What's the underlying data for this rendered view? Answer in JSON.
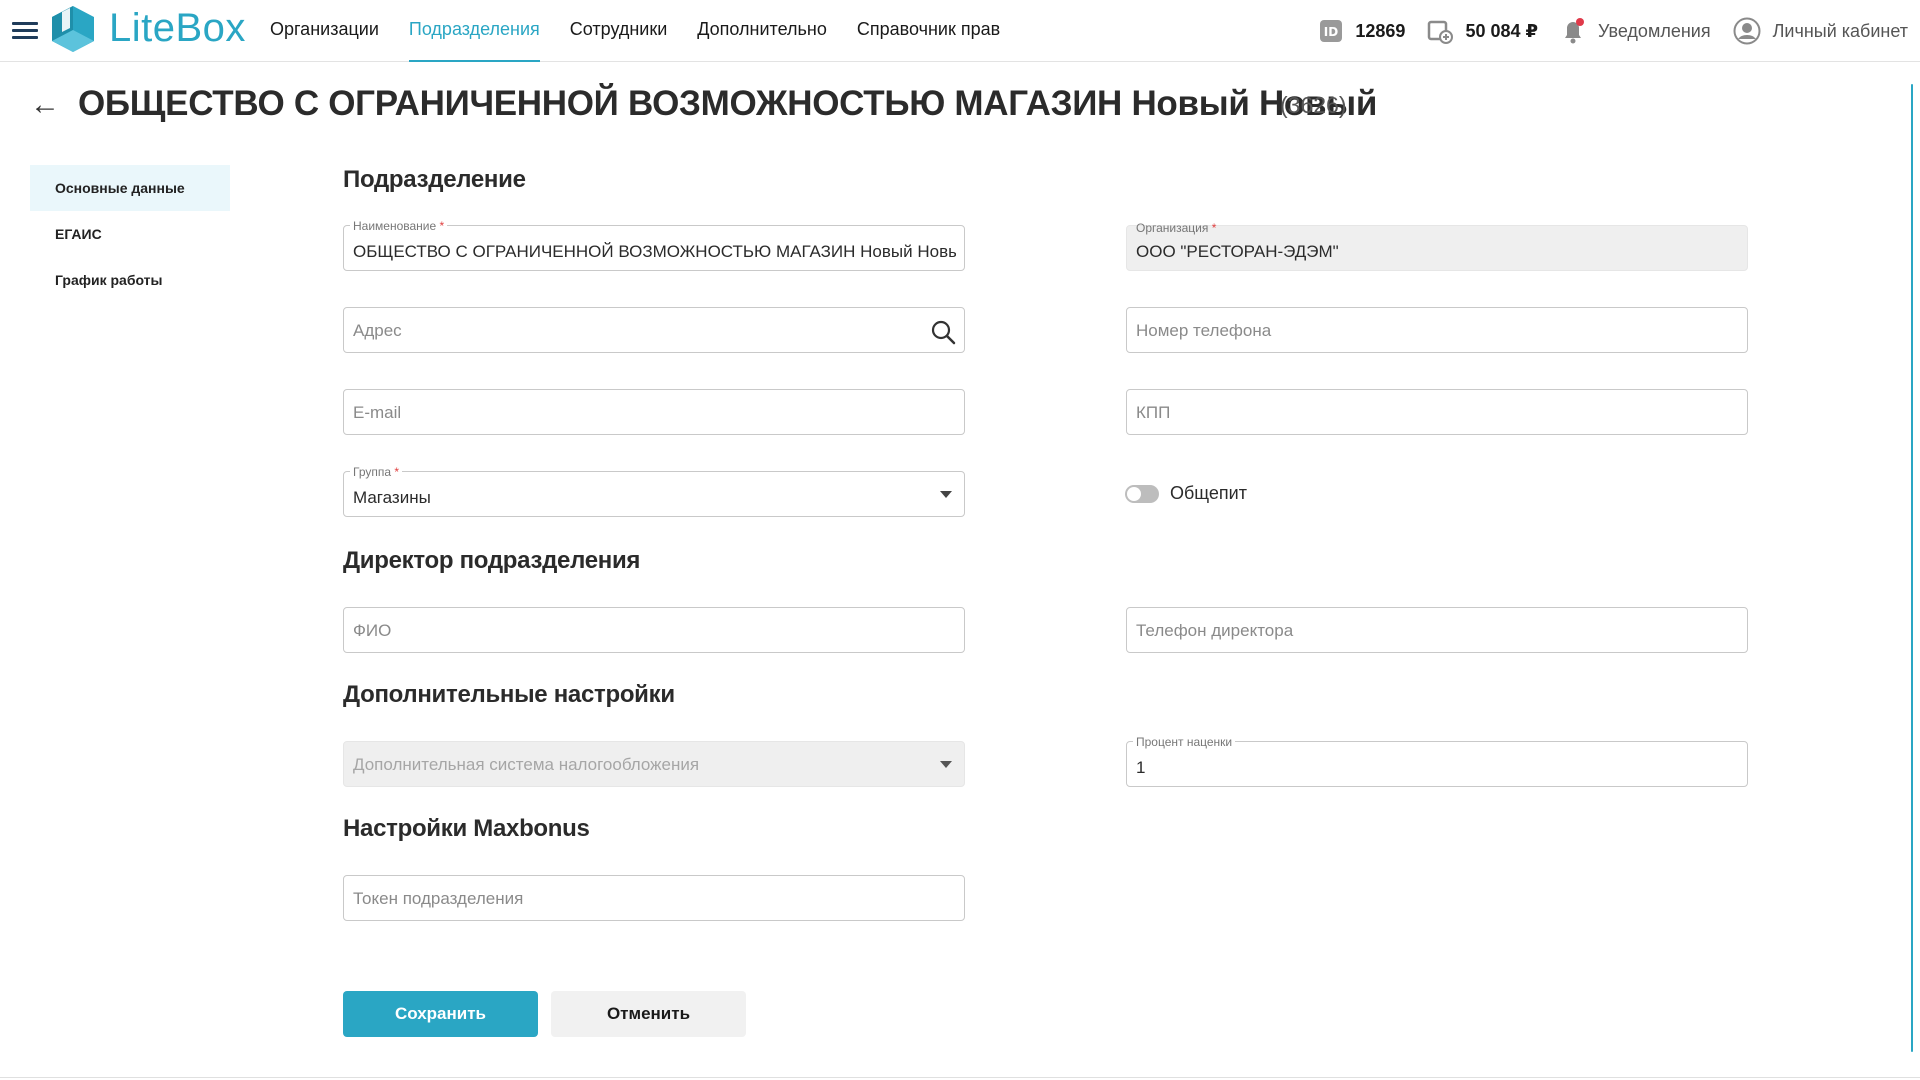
{
  "app": {
    "brand": "LiteBox"
  },
  "nav": {
    "items": [
      {
        "label": "Организации",
        "active": false
      },
      {
        "label": "Подразделения",
        "active": true
      },
      {
        "label": "Сотрудники",
        "active": false
      },
      {
        "label": "Дополнительно",
        "active": false
      },
      {
        "label": "Справочник прав",
        "active": false
      }
    ]
  },
  "header": {
    "id_value": "12869",
    "balance": "50 084 ₽",
    "notifications_label": "Уведомления",
    "account_label": "Личный кабинет"
  },
  "page": {
    "title": "ОБЩЕСТВО С ОГРАНИЧЕННОЙ ВОЗМОЖНОСТЬЮ МАГАЗИН Новый Новый",
    "count": "(3626)"
  },
  "sidemenu": {
    "items": [
      {
        "label": "Основные данные",
        "active": true
      },
      {
        "label": "ЕГАИС",
        "active": false
      },
      {
        "label": "График работы",
        "active": false
      }
    ]
  },
  "sections": {
    "division": "Подразделение",
    "director": "Директор подразделения",
    "additional": "Дополнительные настройки",
    "maxbonus": "Настройки Maxbonus"
  },
  "form": {
    "name": {
      "label": "Наименование",
      "value": "ОБЩЕСТВО С ОГРАНИЧЕННОЙ ВОЗМОЖНОСТЬЮ МАГАЗИН Новый Новый"
    },
    "organization": {
      "label": "Организация",
      "value": "ООО \"РЕСТОРАН-ЭДЭМ\""
    },
    "address": {
      "placeholder": "Адрес"
    },
    "phone": {
      "placeholder": "Номер телефона"
    },
    "email": {
      "placeholder": "E-mail"
    },
    "kpp": {
      "placeholder": "КПП"
    },
    "group": {
      "label": "Группа",
      "value": "Магазины"
    },
    "catering": {
      "label": "Общепит",
      "on": false
    },
    "director_name": {
      "placeholder": "ФИО"
    },
    "director_phone": {
      "placeholder": "Телефон директора"
    },
    "tax_system": {
      "placeholder": "Дополнительная система налогообложения"
    },
    "markup": {
      "label": "Процент наценки",
      "value": "1"
    },
    "token": {
      "placeholder": "Токен подразделения"
    }
  },
  "buttons": {
    "save": "Сохранить",
    "cancel": "Отменить"
  },
  "colors": {
    "accent": "#2aa6c4",
    "notification_dot": "#e03a4a"
  }
}
